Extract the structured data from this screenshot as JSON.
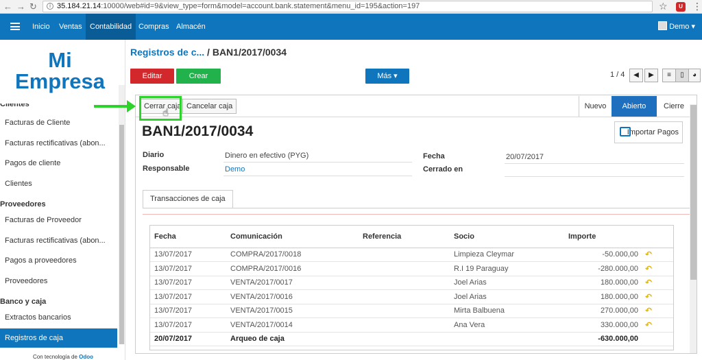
{
  "browser": {
    "url_host": "35.184.21.14",
    "url_rest": ":10000/web#id=9&view_type=form&model=account.bank.statement&menu_id=195&action=197",
    "back_icon": "back-arrow-icon",
    "forward_icon": "forward-arrow-icon",
    "reload_icon": "reload-icon",
    "ext_label": "U"
  },
  "topbar": {
    "menus": [
      "Inicio",
      "Ventas",
      "Contabilidad",
      "Compras",
      "Almacén"
    ],
    "active_menu": "Contabilidad",
    "user": "Demo",
    "color": "#0f75bc"
  },
  "sidebar": {
    "logo_line1": "Mi",
    "logo_line2": "Empresa",
    "sections": [
      {
        "title": "Clientes",
        "items": [
          "Facturas de Cliente",
          "Facturas rectificativas (abon...",
          "Pagos de cliente",
          "Clientes"
        ]
      },
      {
        "title": "Proveedores",
        "items": [
          "Facturas de Proveedor",
          "Facturas rectificativas (abon...",
          "Pagos a proveedores",
          "Proveedores"
        ]
      },
      {
        "title": "Banco y caja",
        "items": [
          "Extractos bancarios",
          "Registros de caja"
        ]
      }
    ],
    "active_item": "Registros de caja",
    "powered_prefix": "Con tecnología de",
    "powered_brand": "Odoo"
  },
  "control": {
    "breadcrumb_parent": "Registros de c...",
    "breadcrumb_sep": "/",
    "breadcrumb_current": "BAN1/2017/0034",
    "edit": "Editar",
    "create": "Crear",
    "more": "Más ▾",
    "pager": "1 / 4"
  },
  "form": {
    "buttons": {
      "close": "Cerrar caja",
      "cancel": "Cancelar caja"
    },
    "stages": [
      "Nuevo",
      "Abierto",
      "Cierre"
    ],
    "active_stage": "Abierto",
    "title": "BAN1/2017/0034",
    "import_button": "Importar Pagos",
    "fields": {
      "diario_label": "Diario",
      "diario_value": "Dinero en efectivo (PYG)",
      "responsable_label": "Responsable",
      "responsable_value": "Demo",
      "fecha_label": "Fecha",
      "fecha_value": "20/07/2017",
      "cerrado_label": "Cerrado en",
      "cerrado_value": ""
    },
    "tab": "Transacciones de caja",
    "table": {
      "headers": [
        "Fecha",
        "Comunicación",
        "Referencia",
        "Socio",
        "Importe"
      ],
      "rows": [
        [
          "13/07/2017",
          "COMPRA/2017/0018",
          "",
          "Limpieza Cleymar",
          "-50.000,00"
        ],
        [
          "13/07/2017",
          "COMPRA/2017/0016",
          "",
          "R.I 19 Paraguay",
          "-280.000,00"
        ],
        [
          "13/07/2017",
          "VENTA/2017/0017",
          "",
          "Joel Arias",
          "180.000,00"
        ],
        [
          "13/07/2017",
          "VENTA/2017/0016",
          "",
          "Joel Arias",
          "180.000,00"
        ],
        [
          "13/07/2017",
          "VENTA/2017/0015",
          "",
          "Mirta Balbuena",
          "270.000,00"
        ],
        [
          "13/07/2017",
          "VENTA/2017/0014",
          "",
          "Ana Vera",
          "330.000,00"
        ]
      ],
      "total_row": [
        "20/07/2017",
        "Arqueo de caja",
        "",
        "",
        "-630.000,00"
      ],
      "row_icon": "reconcile-arrow-icon"
    }
  }
}
